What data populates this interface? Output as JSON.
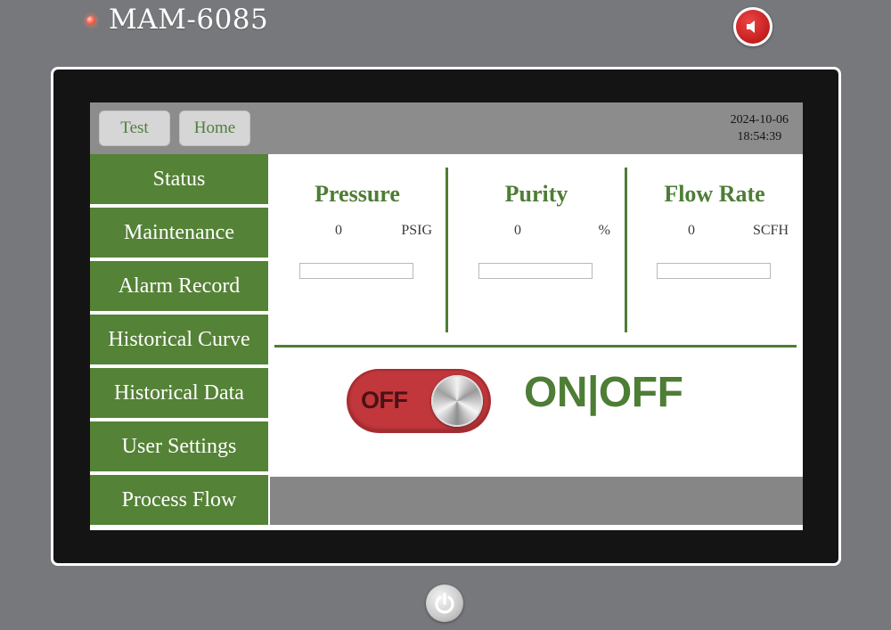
{
  "device": {
    "model": "MAM-6085"
  },
  "topbar": {
    "buttons": [
      {
        "label": "Test"
      },
      {
        "label": "Home"
      }
    ],
    "date": "2024-10-06",
    "time": "18:54:39"
  },
  "sidebar": {
    "items": [
      {
        "label": "Status"
      },
      {
        "label": "Maintenance"
      },
      {
        "label": "Alarm Record"
      },
      {
        "label": "Historical Curve"
      },
      {
        "label": "Historical Data"
      },
      {
        "label": "User Settings"
      },
      {
        "label": "Process Flow"
      }
    ]
  },
  "metrics": [
    {
      "title": "Pressure",
      "value": "0",
      "unit": "PSIG"
    },
    {
      "title": "Purity",
      "value": "0",
      "unit": "%"
    },
    {
      "title": "Flow Rate",
      "value": "0",
      "unit": "SCFH"
    }
  ],
  "control": {
    "toggle_state_label": "OFF",
    "toggle_title": "ON|OFF"
  },
  "icons": {
    "speaker": "speaker-mute-icon",
    "power": "power-icon",
    "led": "status-led-icon"
  },
  "colors": {
    "accent_green": "#548236",
    "toggle_red": "#c2373c",
    "topbar_gray": "#8c8c8c",
    "bezel": "#141414"
  }
}
